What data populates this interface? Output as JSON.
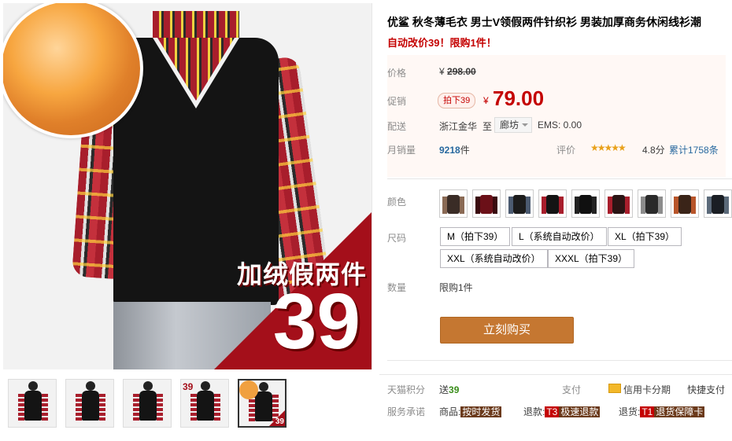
{
  "product": {
    "title": "优鲨 秋冬薄毛衣 男士V领假两件针织衫 男装加厚商务休闲线衫潮",
    "subtitle": "自动改价39！限购1件！",
    "promo_image_text": "加绒假两件",
    "promo_image_number": "39"
  },
  "thumbnails": {
    "badge_text": "39",
    "items": [
      "thumb-1",
      "thumb-2",
      "thumb-3",
      "thumb-4",
      "thumb-5"
    ],
    "selected_index": 4
  },
  "price": {
    "original_label": "价格",
    "currency": "¥",
    "original_value": "298.00",
    "promo_label": "促销",
    "promo_tag": "拍下39",
    "promo_value": "79.00"
  },
  "shipping": {
    "label": "配送",
    "from": "浙江金华",
    "to_word": "至",
    "destination": "廊坊",
    "fee": "EMS: 0.00"
  },
  "sales": {
    "label": "月销量",
    "count": "9218",
    "unit": "件",
    "rating_label": "评价",
    "stars": "★★★★★",
    "score": "4.8分",
    "reviews": "累计1758条"
  },
  "color": {
    "label": "颜色",
    "swatches": [
      {
        "body": "#3a2c26",
        "arm": "#8a6a55"
      },
      {
        "body": "#6b1018",
        "arm": "#3a0a0e"
      },
      {
        "body": "#1c1c1c",
        "arm": "#4b5a70"
      },
      {
        "body": "#141414",
        "arm": "#a81e2c"
      },
      {
        "body": "#101010",
        "arm": "#222222"
      },
      {
        "body": "#2a1414",
        "arm": "#a81e2c"
      },
      {
        "body": "#2a2a2a",
        "arm": "#8c8c8c"
      },
      {
        "body": "#3a2418",
        "arm": "#b8552a"
      },
      {
        "body": "#1a1e24",
        "arm": "#5b6a7a"
      }
    ]
  },
  "sizes": {
    "label": "尺码",
    "options": [
      "M（拍下39）",
      "L（系统自动改价）",
      "XL（拍下39）",
      "XXL（系统自动改价）",
      "XXXL（拍下39）"
    ]
  },
  "quantity": {
    "label": "数量",
    "limit": "限购1件"
  },
  "buy_button": "立刻购买",
  "footer": {
    "points_label": "天猫积分",
    "points_prefix": "送",
    "points_value": "39",
    "pay_label": "支付",
    "credit": "信用卡分期",
    "express": "快捷支付",
    "service_label": "服务承诺",
    "goods_prefix": "商品:",
    "goods_tag": "按时发货",
    "refund_prefix": "退款:",
    "refund_t3": "T3",
    "refund_tag": "极速退款",
    "return_prefix": "退货:",
    "return_t1": "T1",
    "return_tag": "退货保障卡"
  }
}
